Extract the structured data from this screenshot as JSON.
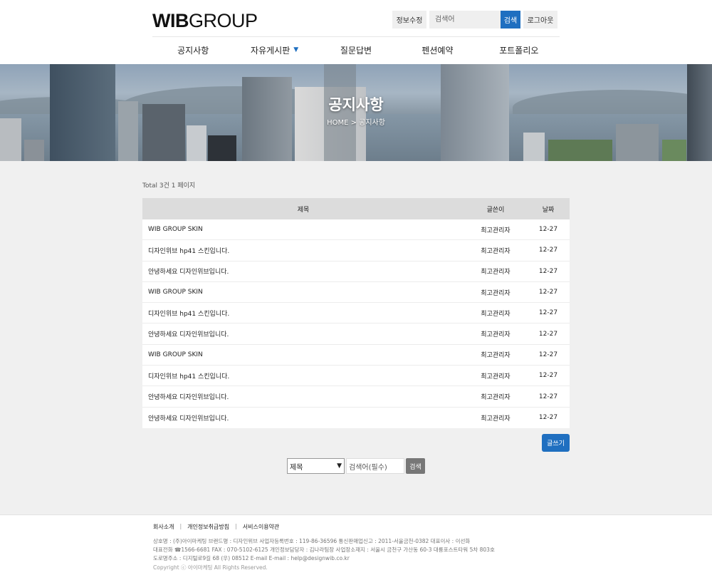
{
  "header": {
    "logo_bold": "WIB",
    "logo_light": "GROUP",
    "util": {
      "edit_label": "정보수정",
      "search_placeholder": "검색어",
      "search_button": "검색",
      "logout_label": "로그아웃"
    },
    "nav": [
      {
        "label": "공지사항"
      },
      {
        "label": "자유게시판",
        "has_dropdown": true
      },
      {
        "label": "질문답변"
      },
      {
        "label": "펜션예약"
      },
      {
        "label": "포트폴리오"
      }
    ]
  },
  "hero": {
    "title": "공지사항",
    "breadcrumb": "HOME > 공지사항"
  },
  "board": {
    "total": "Total 3건 1 페이지",
    "columns": {
      "title": "제목",
      "writer": "글쓴이",
      "date": "날짜"
    },
    "rows": [
      {
        "title": "WIB GROUP SKIN",
        "writer": "최고관리자",
        "date": "12-27"
      },
      {
        "title": "디자인위브 hp41 스킨입니다.",
        "writer": "최고관리자",
        "date": "12-27"
      },
      {
        "title": "안녕하세요 디자인위브입니다.",
        "writer": "최고관리자",
        "date": "12-27"
      },
      {
        "title": "WIB GROUP SKIN",
        "writer": "최고관리자",
        "date": "12-27"
      },
      {
        "title": "디자인위브 hp41 스킨입니다.",
        "writer": "최고관리자",
        "date": "12-27"
      },
      {
        "title": "안녕하세요 디자인위브입니다.",
        "writer": "최고관리자",
        "date": "12-27"
      },
      {
        "title": "WIB GROUP SKIN",
        "writer": "최고관리자",
        "date": "12-27"
      },
      {
        "title": "디자인위브 hp41 스킨입니다.",
        "writer": "최고관리자",
        "date": "12-27"
      },
      {
        "title": "안녕하세요 디자인위브입니다.",
        "writer": "최고관리자",
        "date": "12-27"
      },
      {
        "title": "안녕하세요 디자인위브입니다.",
        "writer": "최고관리자",
        "date": "12-27"
      }
    ],
    "write_button": "글쓰기",
    "search": {
      "field_selected": "제목",
      "keyword_placeholder": "검색어(필수)",
      "button": "검색"
    }
  },
  "footer": {
    "links": [
      "회사소개",
      "개인정보취급방침",
      "서비스이용약관"
    ],
    "info_lines": [
      "상호명 : (주)아이마케팅    브랜드명 : 디자인위브    사업자등록번호 : 119-86-36596    통신판매업신고 : 2011-서울금천-0382    대표이사 : 이선화",
      "대표전화 ☎1566-6681    FAX : 070-5102-6125    개인정보담당자 : 김나라팀장    사업장소재지 : 서울시 금천구 가산동 60-3 대륭포스트타워 5차 803호",
      "도로명주소 : 디지털로9길 68 (우) 08512   E-mail E-mail : help@designwib.co.kr"
    ],
    "copyright": "Copyright ⓒ 아이마케팅 All Rights Reserved."
  },
  "colors": {
    "accent": "#1f6fc0",
    "content_bg": "#f0f0f0",
    "table_head_bg": "#dcdcdc"
  }
}
